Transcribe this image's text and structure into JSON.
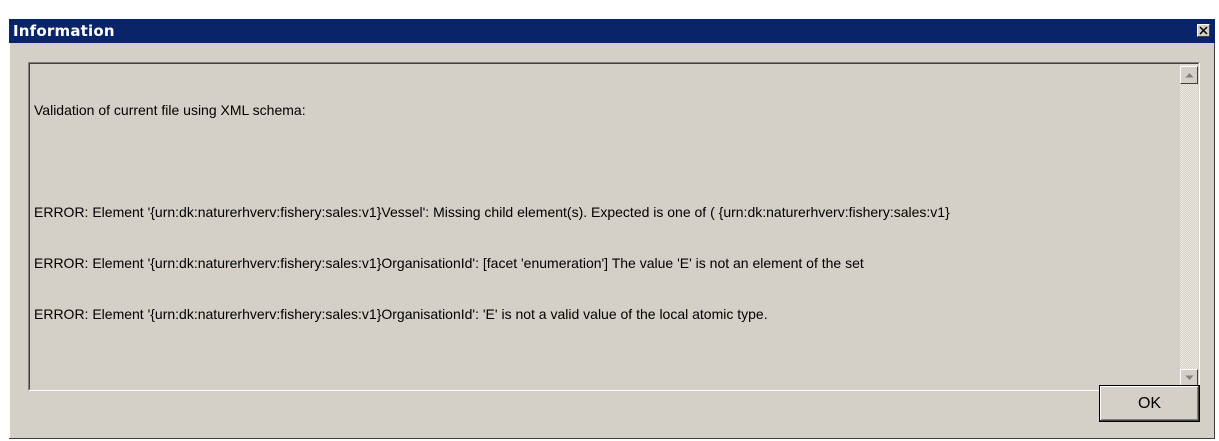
{
  "window": {
    "title": "Information",
    "close_icon": "close-x-icon"
  },
  "message": {
    "lines": [
      "Validation of current file using XML schema:",
      "",
      "ERROR: Element '{urn:dk:naturerhverv:fishery:sales:v1}Vessel': Missing child element(s). Expected is one of ( {urn:dk:naturerhverv:fishery:sales:v1}",
      "ERROR: Element '{urn:dk:naturerhverv:fishery:sales:v1}OrganisationId': [facet 'enumeration'] The value 'E' is not an element of the set",
      "ERROR: Element '{urn:dk:naturerhverv:fishery:sales:v1}OrganisationId': 'E' is not a valid value of the local atomic type."
    ]
  },
  "scrollbar": {
    "up_icon": "arrow-up-icon",
    "down_icon": "arrow-down-icon"
  },
  "buttons": {
    "ok_label": "OK"
  },
  "colors": {
    "titlebar": "#0a246a",
    "face": "#d4d0c8"
  }
}
